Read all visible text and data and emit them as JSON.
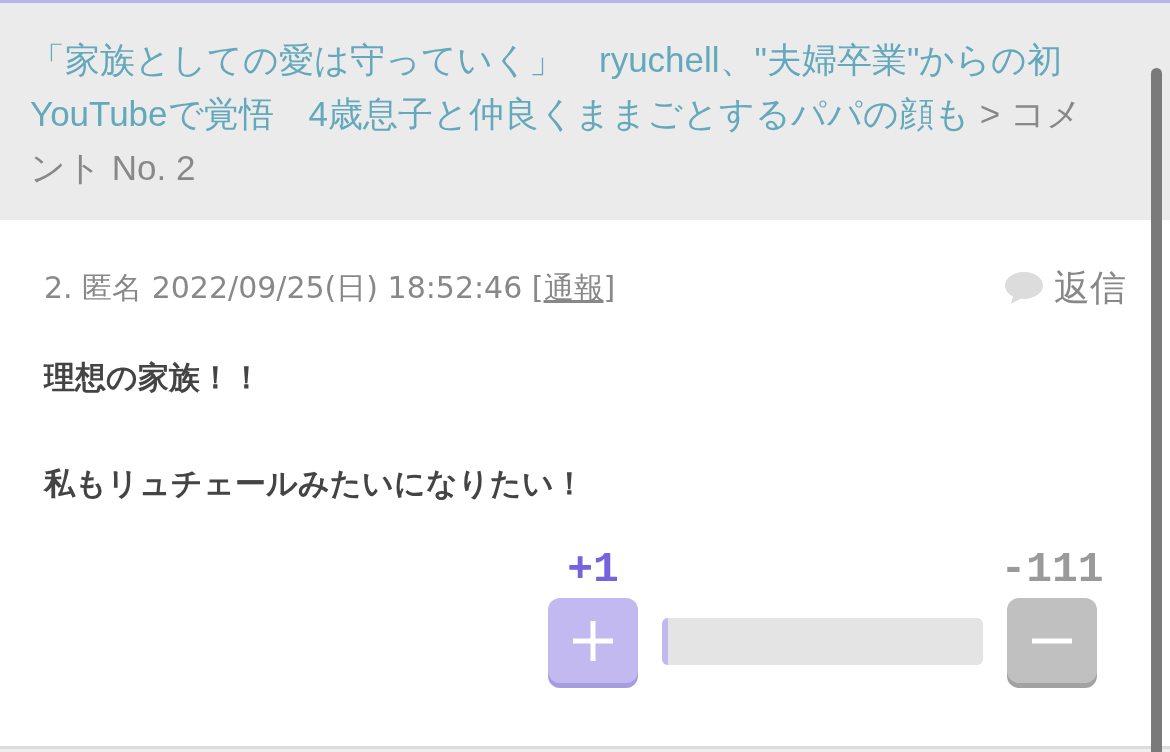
{
  "breadcrumb": {
    "article_link_lines": [
      "「家族としての愛は守っていく」　ryuchell、\"夫婦卒業\"からの初",
      "YouTubeで覚悟　4歳息子と仲良くままごとするパパの顔も"
    ],
    "current": " > コメント No. 2"
  },
  "comment": {
    "meta_prefix": "2. 匿名 2022/09/25(日) 18:52:46 [",
    "report_link": "通報",
    "meta_suffix": "]",
    "reply_button": "返信",
    "body_paragraphs": [
      "理想の家族！！",
      "私もリュチェールみたいになりたい！"
    ],
    "votes": {
      "plus_count": "+1",
      "minus_count": "-111",
      "level": 0.02
    }
  }
}
